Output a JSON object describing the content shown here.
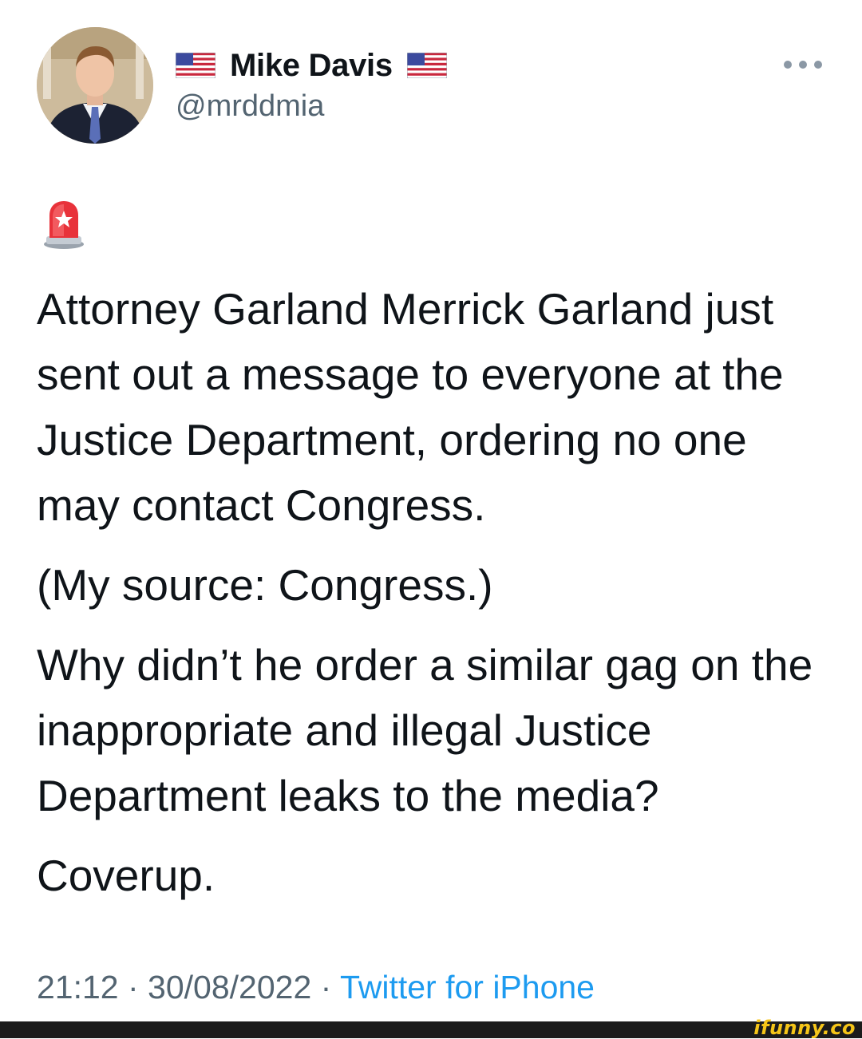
{
  "tweet": {
    "name_prefix_icon": "us-flag-icon",
    "display_name": "Mike Davis",
    "name_suffix_icon": "us-flag-icon",
    "handle": "@mrddmia",
    "lead_icon": "siren-icon",
    "paragraphs": [
      "Attorney Garland Merrick Garland just sent out a message to everyone at the Justice Department, ordering no one may contact Congress.",
      "(My source: Congress.)",
      "Why didn’t he order a similar gag on the inappropriate and illegal Justice Department leaks to the media?",
      "Coverup."
    ],
    "time": "21:12",
    "separator": " · ",
    "date": "30/08/2022",
    "source": "Twitter for iPhone"
  },
  "watermark": "ifunny.co",
  "colors": {
    "text": "#0f1419",
    "secondary": "#536471",
    "link": "#1d9bf0",
    "footer": "#1b1b1b",
    "watermark": "#f5c518"
  }
}
